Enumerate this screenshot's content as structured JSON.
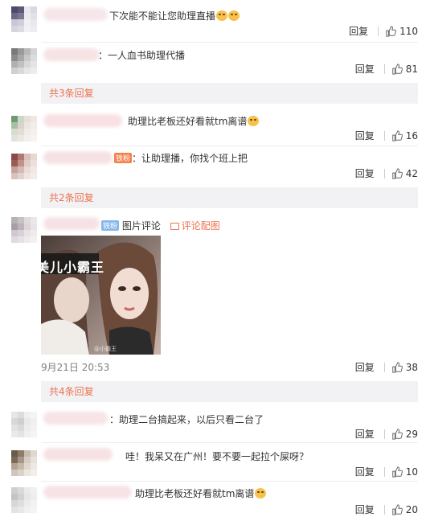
{
  "colors": {
    "accent": "#eb7350",
    "more_bg": "#f2f2f5",
    "meta": "#808080"
  },
  "comments": [
    {
      "text": "下次能不能让您助理直播",
      "emoji_count": 2,
      "reply": "回复",
      "likes": "110"
    },
    {
      "text": "：一人血书助理代播",
      "reply": "回复",
      "likes": "81"
    },
    {
      "text": "助理比老板还好看就tm离谱",
      "emoji_count": 1,
      "reply": "回复",
      "likes": "16"
    },
    {
      "text": "：让助理播，你找个班上把",
      "badge": "铁粉",
      "reply": "回复",
      "likes": "42"
    },
    {
      "text": "图片评论",
      "badge": "铁粉",
      "link": "评论配图",
      "timestamp": "9月21日 20:53",
      "reply": "回复",
      "likes": "38"
    },
    {
      "text": "：助理二台搞起来，以后只看二台了",
      "reply": "回复",
      "likes": "29"
    },
    {
      "text": "哇！我呆又在广州！要不要一起拉个屎呀？",
      "reply": "回复",
      "likes": "10"
    },
    {
      "text": "助理比老板还好看就tm离谱",
      "emoji_count": 1,
      "reply": "回复",
      "likes": "20"
    }
  ],
  "more": [
    {
      "label": "共3条回复"
    },
    {
      "label": "共2条回复"
    },
    {
      "label": "共4条回复"
    }
  ],
  "image": {
    "overlay_text": "美儿小霸王",
    "watermark": "@小霸王"
  }
}
